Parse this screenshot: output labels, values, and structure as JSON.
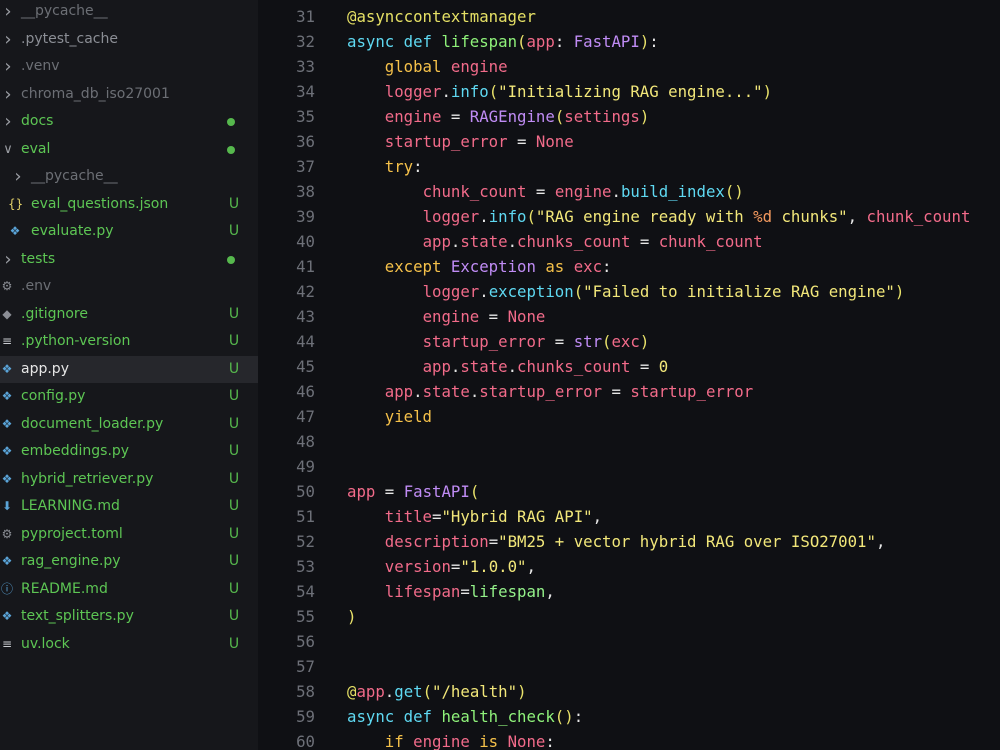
{
  "explorer": {
    "items": [
      {
        "name": "__pycache__",
        "icon": "chevron-right-icon",
        "color": "dim",
        "status": ""
      },
      {
        "name": ".pytest_cache",
        "icon": "chevron-right-icon",
        "color": "ignored",
        "status": ""
      },
      {
        "name": ".venv",
        "icon": "chevron-right-icon",
        "color": "dim",
        "status": ""
      },
      {
        "name": "chroma_db_iso27001",
        "icon": "chevron-right-icon",
        "color": "dim",
        "status": ""
      },
      {
        "name": "docs",
        "icon": "chevron-right-icon",
        "color": "git",
        "status": "dot"
      },
      {
        "name": "eval",
        "icon": "chevron-down-icon",
        "color": "git",
        "status": "dot"
      },
      {
        "name": "__pycache__",
        "icon": "chevron-right-icon",
        "color": "dim",
        "status": ""
      },
      {
        "name": "eval_questions.json",
        "icon": "json-icon",
        "color": "git",
        "status": "U"
      },
      {
        "name": "evaluate.py",
        "icon": "python-icon",
        "color": "git",
        "status": "U"
      },
      {
        "name": "tests",
        "icon": "chevron-right-icon",
        "color": "git",
        "status": "dot"
      },
      {
        "name": ".env",
        "icon": "gear-icon",
        "color": "dim",
        "status": ""
      },
      {
        "name": ".gitignore",
        "icon": "git-icon",
        "color": "git",
        "status": "U"
      },
      {
        "name": ".python-version",
        "icon": "lines-icon",
        "color": "git",
        "status": "U"
      },
      {
        "name": "app.py",
        "icon": "python-icon",
        "color": "sel",
        "status": "U"
      },
      {
        "name": "config.py",
        "icon": "python-icon",
        "color": "git",
        "status": "U"
      },
      {
        "name": "document_loader.py",
        "icon": "python-icon",
        "color": "git",
        "status": "U"
      },
      {
        "name": "embeddings.py",
        "icon": "python-icon",
        "color": "git",
        "status": "U"
      },
      {
        "name": "hybrid_retriever.py",
        "icon": "python-icon",
        "color": "git",
        "status": "U"
      },
      {
        "name": "LEARNING.md",
        "icon": "markdown-icon",
        "color": "git",
        "status": "U"
      },
      {
        "name": "pyproject.toml",
        "icon": "gear-icon",
        "color": "git",
        "status": "U"
      },
      {
        "name": "rag_engine.py",
        "icon": "python-icon",
        "color": "git",
        "status": "U"
      },
      {
        "name": "README.md",
        "icon": "info-icon",
        "color": "git",
        "status": "U"
      },
      {
        "name": "text_splitters.py",
        "icon": "python-icon",
        "color": "git",
        "status": "U"
      },
      {
        "name": "uv.lock",
        "icon": "lines-icon",
        "color": "git",
        "status": "U"
      }
    ]
  },
  "editor": {
    "lines": [
      {
        "n": "31",
        "t": [
          [
            "decorator",
            "@asynccontextmanager"
          ]
        ]
      },
      {
        "n": "32",
        "t": [
          [
            "kw",
            "async "
          ],
          [
            "kw",
            "def "
          ],
          [
            "def",
            "lifespan"
          ],
          [
            "punc",
            "("
          ],
          [
            "param",
            "app"
          ],
          [
            "op",
            ": "
          ],
          [
            "type",
            "FastAPI"
          ],
          [
            "punc",
            ")"
          ],
          [
            "op",
            ":"
          ]
        ]
      },
      {
        "n": "33",
        "t": [
          [
            "plain",
            "    "
          ],
          [
            "kwo",
            "global "
          ],
          [
            "var",
            "engine"
          ]
        ]
      },
      {
        "n": "34",
        "t": [
          [
            "plain",
            "    "
          ],
          [
            "var",
            "logger"
          ],
          [
            "op",
            "."
          ],
          [
            "method",
            "info"
          ],
          [
            "punc",
            "("
          ],
          [
            "str",
            "\"Initializing RAG engine...\""
          ],
          [
            "punc",
            ")"
          ]
        ]
      },
      {
        "n": "35",
        "t": [
          [
            "plain",
            "    "
          ],
          [
            "var",
            "engine"
          ],
          [
            "op",
            " = "
          ],
          [
            "type",
            "RAGEngine"
          ],
          [
            "punc",
            "("
          ],
          [
            "var",
            "settings"
          ],
          [
            "punc",
            ")"
          ]
        ]
      },
      {
        "n": "36",
        "t": [
          [
            "plain",
            "    "
          ],
          [
            "var",
            "startup_error"
          ],
          [
            "op",
            " = "
          ],
          [
            "const",
            "None"
          ]
        ]
      },
      {
        "n": "37",
        "t": [
          [
            "plain",
            "    "
          ],
          [
            "kwo",
            "try"
          ],
          [
            "op",
            ":"
          ]
        ]
      },
      {
        "n": "38",
        "t": [
          [
            "plain",
            "        "
          ],
          [
            "var",
            "chunk_count"
          ],
          [
            "op",
            " = "
          ],
          [
            "var",
            "engine"
          ],
          [
            "op",
            "."
          ],
          [
            "method",
            "build_index"
          ],
          [
            "punc",
            "()"
          ]
        ]
      },
      {
        "n": "39",
        "t": [
          [
            "plain",
            "        "
          ],
          [
            "var",
            "logger"
          ],
          [
            "op",
            "."
          ],
          [
            "method",
            "info"
          ],
          [
            "punc",
            "("
          ],
          [
            "str",
            "\"RAG engine ready with "
          ],
          [
            "fmt",
            "%d"
          ],
          [
            "str",
            " chunks\""
          ],
          [
            "op",
            ", "
          ],
          [
            "var",
            "chunk_count"
          ]
        ]
      },
      {
        "n": "40",
        "t": [
          [
            "plain",
            "        "
          ],
          [
            "var",
            "app"
          ],
          [
            "op",
            "."
          ],
          [
            "attr",
            "state"
          ],
          [
            "op",
            "."
          ],
          [
            "attr",
            "chunks_count"
          ],
          [
            "op",
            " = "
          ],
          [
            "var",
            "chunk_count"
          ]
        ]
      },
      {
        "n": "41",
        "t": [
          [
            "plain",
            "    "
          ],
          [
            "kwo",
            "except "
          ],
          [
            "type",
            "Exception"
          ],
          [
            "kwo",
            " as "
          ],
          [
            "var",
            "exc"
          ],
          [
            "op",
            ":"
          ]
        ]
      },
      {
        "n": "42",
        "t": [
          [
            "plain",
            "        "
          ],
          [
            "var",
            "logger"
          ],
          [
            "op",
            "."
          ],
          [
            "method",
            "exception"
          ],
          [
            "punc",
            "("
          ],
          [
            "str",
            "\"Failed to initialize RAG engine\""
          ],
          [
            "punc",
            ")"
          ]
        ]
      },
      {
        "n": "43",
        "t": [
          [
            "plain",
            "        "
          ],
          [
            "var",
            "engine"
          ],
          [
            "op",
            " = "
          ],
          [
            "const",
            "None"
          ]
        ]
      },
      {
        "n": "44",
        "t": [
          [
            "plain",
            "        "
          ],
          [
            "var",
            "startup_error"
          ],
          [
            "op",
            " = "
          ],
          [
            "builtin",
            "str"
          ],
          [
            "punc",
            "("
          ],
          [
            "var",
            "exc"
          ],
          [
            "punc",
            ")"
          ]
        ]
      },
      {
        "n": "45",
        "t": [
          [
            "plain",
            "        "
          ],
          [
            "var",
            "app"
          ],
          [
            "op",
            "."
          ],
          [
            "attr",
            "state"
          ],
          [
            "op",
            "."
          ],
          [
            "attr",
            "chunks_count"
          ],
          [
            "op",
            " = "
          ],
          [
            "num",
            "0"
          ]
        ]
      },
      {
        "n": "46",
        "t": [
          [
            "plain",
            "    "
          ],
          [
            "var",
            "app"
          ],
          [
            "op",
            "."
          ],
          [
            "attr",
            "state"
          ],
          [
            "op",
            "."
          ],
          [
            "attr",
            "startup_error"
          ],
          [
            "op",
            " = "
          ],
          [
            "var",
            "startup_error"
          ]
        ]
      },
      {
        "n": "47",
        "t": [
          [
            "plain",
            "    "
          ],
          [
            "kwo",
            "yield"
          ]
        ]
      },
      {
        "n": "48",
        "t": []
      },
      {
        "n": "49",
        "t": []
      },
      {
        "n": "50",
        "t": [
          [
            "var",
            "app"
          ],
          [
            "op",
            " = "
          ],
          [
            "type",
            "FastAPI"
          ],
          [
            "punc",
            "("
          ]
        ]
      },
      {
        "n": "51",
        "t": [
          [
            "plain",
            "    "
          ],
          [
            "kwarg",
            "title"
          ],
          [
            "op",
            "="
          ],
          [
            "str",
            "\"Hybrid RAG API\""
          ],
          [
            "op",
            ","
          ]
        ]
      },
      {
        "n": "52",
        "t": [
          [
            "plain",
            "    "
          ],
          [
            "kwarg",
            "description"
          ],
          [
            "op",
            "="
          ],
          [
            "str",
            "\"BM25 + vector hybrid RAG over ISO27001\""
          ],
          [
            "op",
            ","
          ]
        ]
      },
      {
        "n": "53",
        "t": [
          [
            "plain",
            "    "
          ],
          [
            "kwarg",
            "version"
          ],
          [
            "op",
            "="
          ],
          [
            "str",
            "\"1.0.0\""
          ],
          [
            "op",
            ","
          ]
        ]
      },
      {
        "n": "54",
        "t": [
          [
            "plain",
            "    "
          ],
          [
            "kwarg",
            "lifespan"
          ],
          [
            "op",
            "="
          ],
          [
            "fn",
            "lifespan"
          ],
          [
            "op",
            ","
          ]
        ]
      },
      {
        "n": "55",
        "t": [
          [
            "punc",
            ")"
          ]
        ]
      },
      {
        "n": "56",
        "t": []
      },
      {
        "n": "57",
        "t": []
      },
      {
        "n": "58",
        "t": [
          [
            "decorator",
            "@"
          ],
          [
            "var",
            "app"
          ],
          [
            "op",
            "."
          ],
          [
            "method",
            "get"
          ],
          [
            "punc",
            "("
          ],
          [
            "str",
            "\"/health\""
          ],
          [
            "punc",
            ")"
          ]
        ]
      },
      {
        "n": "59",
        "t": [
          [
            "kw",
            "async "
          ],
          [
            "kw",
            "def "
          ],
          [
            "def",
            "health_check"
          ],
          [
            "punc",
            "()"
          ],
          [
            "op",
            ":"
          ]
        ]
      },
      {
        "n": "60",
        "t": [
          [
            "plain",
            "    "
          ],
          [
            "kwo",
            "if "
          ],
          [
            "var",
            "engine"
          ],
          [
            "kwo",
            " is "
          ],
          [
            "const",
            "None"
          ],
          [
            "op",
            ":"
          ]
        ]
      }
    ]
  },
  "colors": {
    "background": "#0f1014",
    "sidebar": "#16171b",
    "selected_row": "#26272c",
    "git_untracked": "#5dc654"
  }
}
